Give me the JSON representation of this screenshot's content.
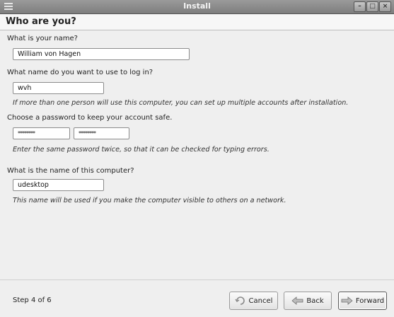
{
  "window": {
    "title": "Install"
  },
  "header": {
    "title": "Who are you?"
  },
  "form": {
    "name": {
      "label": "What is your name?",
      "value": "William von Hagen"
    },
    "login": {
      "label": "What name do you want to use to log in?",
      "value": "wvh",
      "hint": "If more than one person will use this computer, you can set up multiple accounts after installation."
    },
    "password": {
      "label": "Choose a password to keep your account safe.",
      "value": "********",
      "confirm_value": "********",
      "hint": "Enter the same password twice, so that it can be checked for typing errors."
    },
    "computer": {
      "label": "What is the name of this computer?",
      "value": "udesktop",
      "hint": "This name will be used if you make the computer visible to others on a network."
    }
  },
  "footer": {
    "step": "Step 4 of 6",
    "cancel_label": "Cancel",
    "back_label": "Back",
    "forward_label": "Forward"
  },
  "icons": {
    "window_menu": "window-menu-icon",
    "minimize": "minimize-icon",
    "maximize": "maximize-icon",
    "close": "close-icon",
    "cancel": "cancel-icon",
    "back": "back-arrow-icon",
    "forward": "forward-arrow-icon"
  }
}
